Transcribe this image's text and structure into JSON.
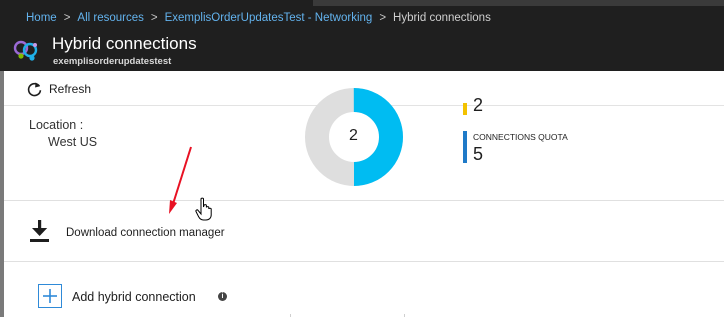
{
  "breadcrumb": {
    "items": [
      "Home",
      "All resources",
      "ExemplisOrderUpdatesTest - Networking",
      "Hybrid connections"
    ],
    "separator": ">"
  },
  "blade": {
    "icon": "hybrid-connections-icon",
    "title": "Hybrid connections",
    "subtitle": "exemplisorderupdatestest"
  },
  "command_bar": {
    "refresh_label": "Refresh",
    "refresh_icon": "refresh-icon"
  },
  "location": {
    "label": "Location :",
    "value": "West US"
  },
  "donut": {
    "value": "2",
    "fill_fraction": 0.5,
    "filled_color": "#00bcf2",
    "remaining_color": "#dedede"
  },
  "stats": {
    "top_value": "2",
    "top_color": "#f3c200",
    "quota_label": "CONNECTIONS QUOTA",
    "quota_value": "5",
    "quota_color": "#1f7ac8"
  },
  "download": {
    "icon": "download-icon",
    "label": "Download connection manager"
  },
  "add": {
    "icon": "plus-icon",
    "label": "Add hybrid connection",
    "info_icon": "info-icon",
    "info_glyph": "i"
  },
  "colors": {
    "header_bg": "#1f1f1f",
    "link": "#63b3ee",
    "accent": "#2f8ad8",
    "annotation": "#e81123"
  }
}
